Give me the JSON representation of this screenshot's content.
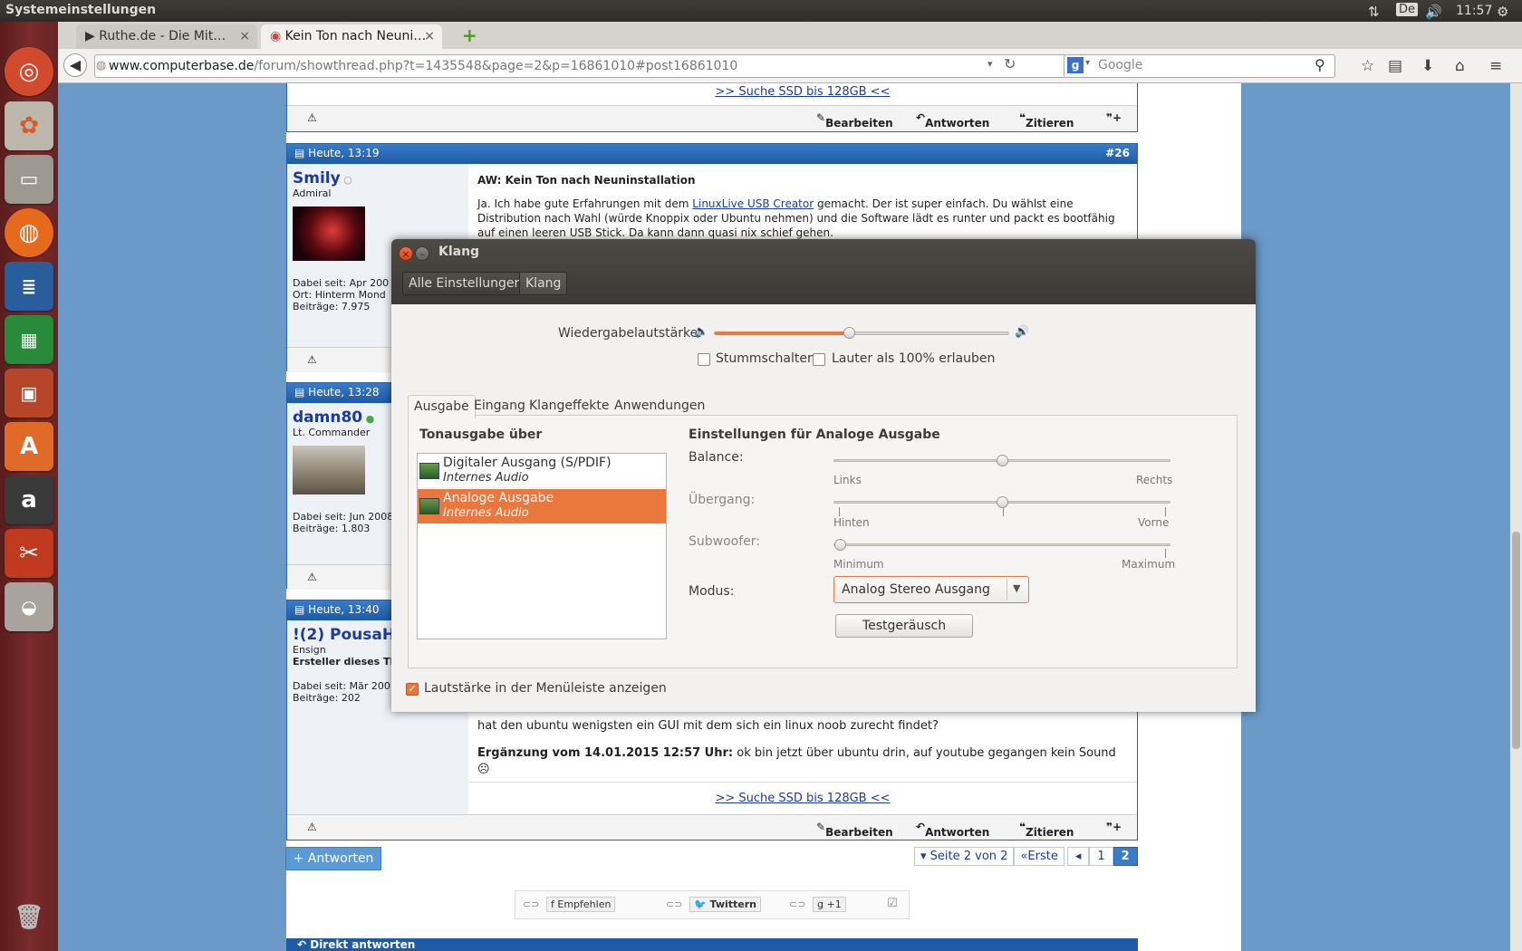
{
  "panel": {
    "title": "Systemeinstellungen",
    "keyboard": "De",
    "time": "11:57"
  },
  "launcher": {
    "items": [
      "ubuntu-dash-icon",
      "system-tools-icon",
      "files-icon",
      "firefox-icon",
      "writer-icon",
      "calc-icon",
      "impress-icon",
      "software-center-icon",
      "amazon-icon",
      "system-settings-icon",
      "disk-icon",
      "trash-icon"
    ]
  },
  "browser": {
    "tabs": [
      {
        "label": "▶ Ruthe.de - Die Mit…"
      },
      {
        "label": "Kein Ton nach Neuni…"
      }
    ],
    "url_host": "www.computerbase.de",
    "url_path": "/forum/showthread.php?t=1435548&page=2&p=16861010#post16861010",
    "search_placeholder": "Google"
  },
  "forum": {
    "ssd_link": ">> Suche SSD bis 128GB <<",
    "footer_actions": {
      "edit": "Bearbeiten",
      "reply": "Antworten",
      "quote": "Zitieren"
    },
    "posts": [
      {
        "date": "Heute, 13:19",
        "number": "#26",
        "user": "Smily",
        "rank": "Admiral",
        "info1": "Dabei seit: Apr 200",
        "info2": "Ort: Hinterm Mond",
        "info3": "Beiträge: 7.975",
        "title": "AW: Kein Ton nach Neuninstallation",
        "text_a": "Ja. Ich habe gute Erfahrungen mit dem ",
        "link": "LinuxLive USB Creator",
        "text_b": " gemacht. Der ist super einfach. Du wählst eine",
        "line2": "Distribution nach Wahl (würde Knoppix oder Ubuntu nehmen) und die Software lädt es runter und packt es bootfähig",
        "line3": "auf einen leeren USB Stick. Da kann dann quasi nix schief gehen."
      },
      {
        "date": "Heute, 13:28",
        "user": "damn80",
        "rank": "Lt. Commander",
        "info1": "Dabei seit: Jun 2008",
        "info2": "Beiträge: 1.803"
      },
      {
        "date": "Heute, 13:40",
        "user": "!(2) PousaH",
        "rank": "Ensign",
        "extra": "Ersteller dieses The",
        "info1": "Dabei seit: Mär 200",
        "info2": "Beiträge: 202",
        "line1": "hat den ubuntu wenigsten ein GUI mit dem sich ein linux noob zurecht findet?",
        "addition_label": "Ergänzung vom 14.01.2015 12:57 Uhr:",
        "addition_text": " ok bin jetzt über ubuntu drin, auf youtube gegangen kein Sound ☹"
      }
    ],
    "reply_button": "+ Antworten",
    "pagination": {
      "label": "Seite 2 von 2",
      "first": "«Erste",
      "prev": "◂",
      "p1": "1",
      "p2": "2"
    },
    "social": {
      "recommend": "Empfehlen",
      "tweet": "Twittern",
      "plus": "+1"
    },
    "direct_reply": "Direkt antworten"
  },
  "dialog": {
    "title": "Klang",
    "crumbs": [
      "Alle Einstellungen",
      "Klang"
    ],
    "volume_label": "Wiedergabelautstärke:",
    "volume_level": 0.46,
    "mute_label": "Stummschalten",
    "louder_label": "Lauter als 100% erlauben",
    "tabs": [
      "Ausgabe",
      "Eingang",
      "Klangeffekte",
      "Anwendungen"
    ],
    "output_header": "Tonausgabe über",
    "devices": [
      {
        "name": "Digitaler Ausgang (S/PDIF)",
        "sub": "Internes Audio",
        "selected": false
      },
      {
        "name": "Analoge Ausgabe",
        "sub": "Internes Audio",
        "selected": true
      }
    ],
    "settings_header": "Einstellungen für Analoge Ausgabe",
    "balance": {
      "label": "Balance:",
      "left": "Links",
      "right": "Rechts",
      "value": 0.5
    },
    "fade": {
      "label": "Übergang:",
      "left": "Hinten",
      "right": "Vorne",
      "value": 0.5
    },
    "subwoofer": {
      "label": "Subwoofer:",
      "left": "Minimum",
      "right": "Maximum",
      "value": 0.0
    },
    "mode": {
      "label": "Modus:",
      "value": "Analog Stereo Ausgang"
    },
    "test_button": "Testgeräusch",
    "show_volume_label": "Lautstärke in der Menüleiste anzeigen",
    "accent": "#e9773e"
  }
}
